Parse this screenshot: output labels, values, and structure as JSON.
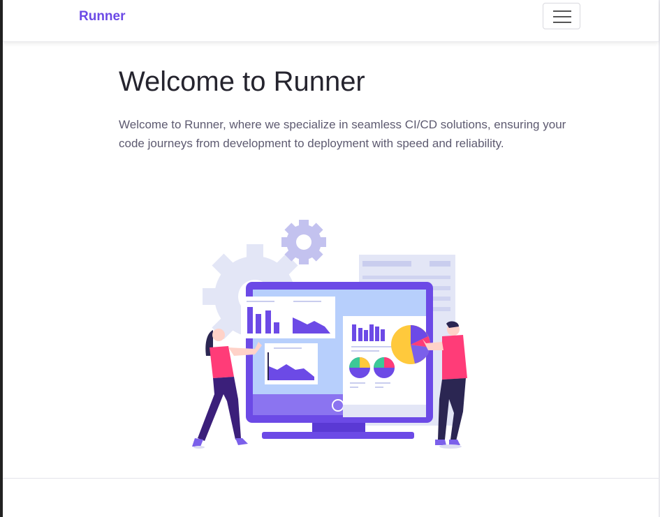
{
  "navbar": {
    "brand": "Runner",
    "toggle_icon": "hamburger-menu-icon"
  },
  "hero": {
    "title": "Welcome to Runner",
    "lead": "Welcome to Runner, where we specialize in seamless CI/CD solutions, ensuring your code journeys from development to deployment with speed and reliability."
  },
  "illustration": {
    "icon": "analytics-dashboard-illustration",
    "colors": {
      "primary": "#6c4ae6",
      "light": "#d9dcf5",
      "screen": "#b7cffc",
      "accent_pink": "#ff3c78",
      "accent_yellow": "#ffc93c",
      "dark_navy": "#2b2652"
    }
  }
}
